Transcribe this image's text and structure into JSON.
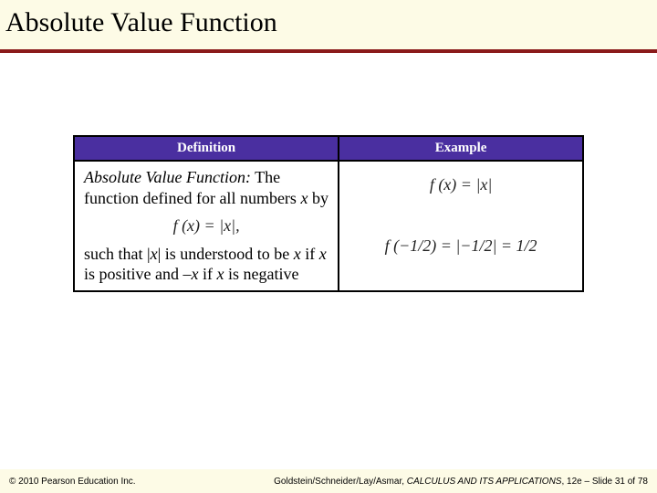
{
  "title": "Absolute Value Function",
  "table": {
    "headers": {
      "definition": "Definition",
      "example": "Example"
    },
    "definition": {
      "term": "Absolute Value Function:",
      "body1": "The function defined for all numbers ",
      "var1": "x",
      "body1_end": " by",
      "eq1": "f (x) = |x|,",
      "body2a": "such that |",
      "var2": "x",
      "body2b": "| is understood to be ",
      "var3": "x",
      "body2c": " if ",
      "var4": "x",
      "body2d": " is positive and –",
      "var5": "x",
      "body2e": " if ",
      "var6": "x",
      "body2f": " is negative"
    },
    "example": {
      "eq1": "f (x) = |x|",
      "eq2": "f (−1/2) = |−1/2| = 1/2"
    }
  },
  "footer": {
    "left": "© 2010 Pearson Education Inc.",
    "right_authors": "Goldstein/Schneider/Lay/Asmar, ",
    "right_title": "CALCULUS AND ITS APPLICATIONS",
    "right_tail": ", 12e – Slide 31 of 78"
  }
}
